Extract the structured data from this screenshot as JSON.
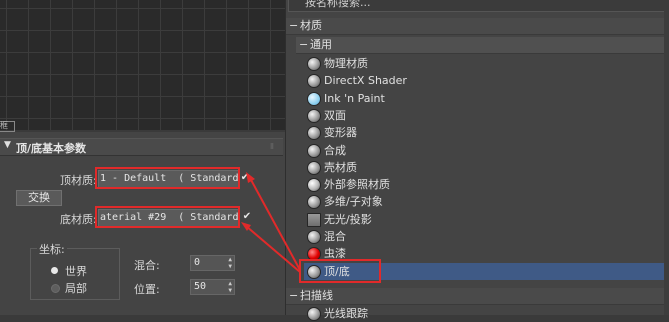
{
  "viewport": {
    "corner_label": "框"
  },
  "rollout": {
    "toggle": "▼",
    "title": "顶/底基本参数",
    "grip": "⁝⁝"
  },
  "params": {
    "top_label": "顶材质:",
    "top_material": "1 - Default  ( Standard",
    "top_checked": "✔",
    "swap_label": "交换",
    "bottom_label": "底材质:",
    "bottom_material": "aterial #29  ( Standard",
    "bottom_checked": "✔",
    "coord_title": "坐标:",
    "coord_world": "世界",
    "coord_local": "局部",
    "blend_label": "混合:",
    "blend_value": "0",
    "position_label": "位置:",
    "position_value": "50"
  },
  "browser": {
    "search_placeholder": "按名称搜索...",
    "section_materials": {
      "sign": "−",
      "label": "材质"
    },
    "section_general": {
      "sign": "−",
      "label": "通用"
    },
    "items": [
      {
        "label": "物理材质",
        "icon": "sphere-icon"
      },
      {
        "label": "DirectX Shader",
        "icon": "sphere-icon"
      },
      {
        "label": "Ink 'n Paint",
        "icon": "paint-sphere-icon"
      },
      {
        "label": "双面",
        "icon": "sphere-icon"
      },
      {
        "label": "变形器",
        "icon": "sphere-icon"
      },
      {
        "label": "合成",
        "icon": "sphere-icon"
      },
      {
        "label": "壳材质",
        "icon": "sphere-icon"
      },
      {
        "label": "外部参照材质",
        "icon": "external-sphere-icon"
      },
      {
        "label": "多维/子对象",
        "icon": "sphere-icon"
      },
      {
        "label": "无光/投影",
        "icon": "flat-icon"
      },
      {
        "label": "混合",
        "icon": "sphere-icon"
      },
      {
        "label": "虫漆",
        "icon": "red-sphere-icon"
      },
      {
        "label": "顶/底",
        "icon": "sphere-icon",
        "selected": true
      }
    ],
    "section_scanline": {
      "sign": "−",
      "label": "扫描线"
    },
    "next_item": "光线跟踪"
  },
  "colors": {
    "highlight": "#e12a2a",
    "selection": "#3f5a86"
  }
}
